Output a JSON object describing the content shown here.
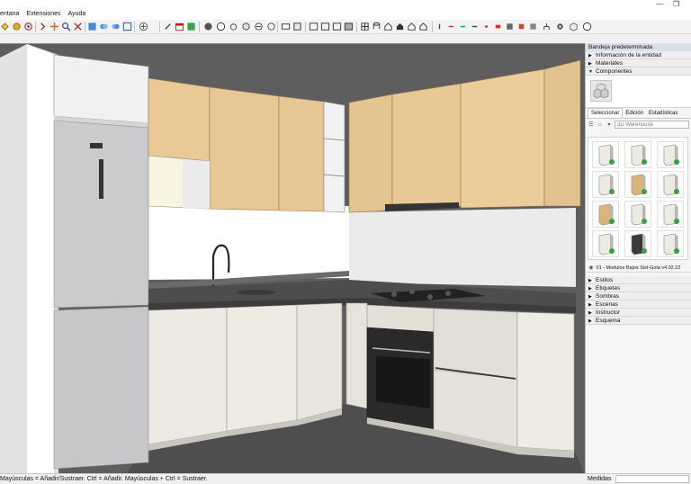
{
  "menubar": {
    "items": [
      "entana",
      "Extensiones",
      "Ayuda"
    ]
  },
  "tray": {
    "title": "Bandeja predeterminada",
    "top_sections": [
      {
        "label": "Información de la entidad",
        "state": "collapsed"
      },
      {
        "label": "Materiales",
        "state": "collapsed"
      },
      {
        "label": "Componentes",
        "state": "expanded"
      }
    ],
    "tabs": [
      "Seleccionar",
      "Edición",
      "Estadísticas"
    ],
    "search_placeholder": "3D Warehouse",
    "model_name": "01 - Modulos Bajos Sist-Gola v4.02.22",
    "bottom_sections": [
      "Estilos",
      "Etiquetas",
      "Sombras",
      "Escenas",
      "Instructor",
      "Esquema"
    ]
  },
  "status": {
    "hint": "Mayúsculas = Añadir/Sustraer. Ctrl = Añadir. Mayúsculas + Ctrl = Sustraer.",
    "measure_label": "Medidas"
  },
  "icons": [
    "restore-icon",
    "close-icon",
    "search-icon",
    "home-icon",
    "dropdown-icon",
    "back-icon",
    "forward-icon"
  ]
}
